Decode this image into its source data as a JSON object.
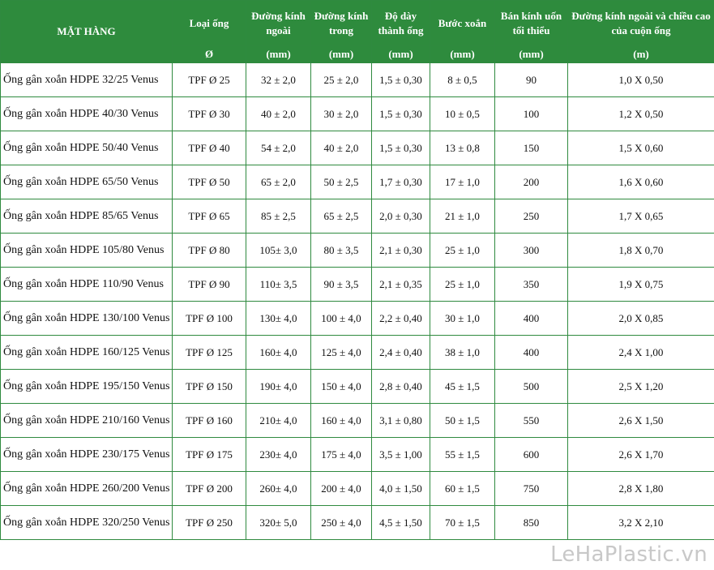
{
  "table": {
    "headers": [
      "MẶT HÀNG",
      "Loại ống",
      "Đường kính ngoài",
      "Đường kính trong",
      "Độ dày thành ống",
      "Bước xoắn",
      "Bán kính uốn tối thiểu",
      "Đường kính ngoài và chiều cao của cuộn ống"
    ],
    "units": [
      "Ø",
      "(mm)",
      "(mm)",
      "(mm)",
      "(mm)",
      "(mm)",
      "(m)"
    ],
    "rows": [
      [
        "Ống gân xoắn HDPE 32/25 Venus",
        "TPF Ø 25",
        "32 ± 2,0",
        "25 ± 2,0",
        "1,5 ± 0,30",
        "8 ± 0,5",
        "90",
        "1,0 X 0,50"
      ],
      [
        "Ống gân xoắn HDPE 40/30 Venus",
        "TPF Ø 30",
        "40 ± 2,0",
        "30 ± 2,0",
        "1,5 ± 0,30",
        "10 ± 0,5",
        "100",
        "1,2 X 0,50"
      ],
      [
        "Ống gân xoắn HDPE 50/40 Venus",
        "TPF Ø 40",
        "54 ± 2,0",
        "40 ± 2,0",
        "1,5 ± 0,30",
        "13 ± 0,8",
        "150",
        "1,5 X 0,60"
      ],
      [
        "Ống gân xoắn HDPE 65/50 Venus",
        "TPF Ø 50",
        "65 ± 2,0",
        "50 ± 2,5",
        "1,7 ± 0,30",
        "17 ± 1,0",
        "200",
        "1,6 X 0,60"
      ],
      [
        "Ống gân xoắn HDPE 85/65 Venus",
        "TPF Ø 65",
        "85 ± 2,5",
        "65 ± 2,5",
        "2,0 ± 0,30",
        "21 ± 1,0",
        "250",
        "1,7 X 0,65"
      ],
      [
        "Ống gân xoắn HDPE 105/80 Venus",
        "TPF Ø 80",
        "105± 3,0",
        "80 ± 3,5",
        "2,1 ± 0,30",
        "25 ± 1,0",
        "300",
        "1,8 X 0,70"
      ],
      [
        "Ống gân xoắn HDPE 110/90 Venus",
        "TPF Ø 90",
        "110± 3,5",
        "90 ± 3,5",
        "2,1 ± 0,35",
        "25 ± 1,0",
        "350",
        "1,9 X 0,75"
      ],
      [
        "Ống gân xoắn HDPE 130/100 Venus",
        "TPF Ø 100",
        "130± 4,0",
        "100 ± 4,0",
        "2,2 ± 0,40",
        "30 ± 1,0",
        "400",
        "2,0 X 0,85"
      ],
      [
        "Ống gân xoắn HDPE 160/125 Venus",
        "TPF Ø 125",
        "160± 4,0",
        "125 ± 4,0",
        "2,4 ± 0,40",
        "38 ± 1,0",
        "400",
        "2,4 X 1,00"
      ],
      [
        "Ống gân xoắn HDPE 195/150 Venus",
        "TPF Ø 150",
        "190± 4,0",
        "150 ± 4,0",
        "2,8 ± 0,40",
        "45 ± 1,5",
        "500",
        "2,5 X 1,20"
      ],
      [
        "Ống gân xoắn HDPE 210/160 Venus",
        "TPF Ø 160",
        "210± 4,0",
        "160 ± 4,0",
        "3,1 ± 0,80",
        "50 ± 1,5",
        "550",
        "2,6 X 1,50"
      ],
      [
        "Ống gân xoắn HDPE 230/175 Venus",
        "TPF Ø 175",
        "230± 4,0",
        "175 ± 4,0",
        "3,5 ± 1,00",
        "55 ± 1,5",
        "600",
        "2,6 X 1,70"
      ],
      [
        "Ống gân xoắn HDPE 260/200 Venus",
        "TPF Ø 200",
        "260± 4,0",
        "200 ± 4,0",
        "4,0 ± 1,50",
        "60 ± 1,5",
        "750",
        "2,8 X 1,80"
      ],
      [
        "Ống gân xoắn HDPE 320/250 Venus",
        "TPF Ø 250",
        "320± 5,0",
        "250 ± 4,0",
        "4,5 ± 1,50",
        "70 ± 1,5",
        "850",
        "3,2 X 2,10"
      ]
    ]
  },
  "watermark": "LeHaPlastic.vn",
  "colors": {
    "header_bg": "#2e8b3d",
    "header_text": "#ffffff",
    "border": "#2f8a3f",
    "watermark": "#c8c8c8"
  }
}
